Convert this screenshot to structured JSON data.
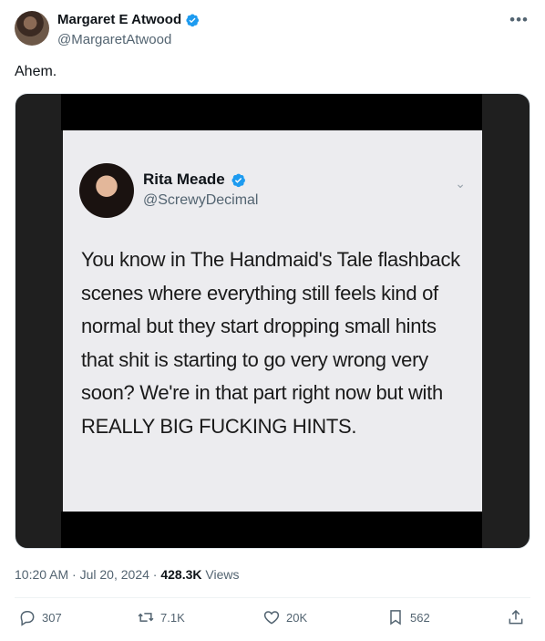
{
  "author": {
    "name": "Margaret E Atwood",
    "handle": "@MargaretAtwood"
  },
  "post": {
    "text": "Ahem."
  },
  "media": {
    "embedded_post": {
      "name": "Rita Meade",
      "handle": "@ScrewyDecimal",
      "text": "You know in The Handmaid's Tale flashback scenes where everything still feels kind of normal but they start dropping small hints that shit is starting to go very wrong very soon? We're in that part right now but with REALLY BIG FUCKING HINTS."
    }
  },
  "meta": {
    "time": "10:20 AM",
    "separator": " · ",
    "date": "Jul 20, 2024",
    "views_count": "428.3K",
    "views_label": " Views"
  },
  "actions": {
    "replies": "307",
    "reposts": "7.1K",
    "likes": "20K",
    "bookmarks": "562"
  },
  "colors": {
    "verified": "#1d9bf0",
    "muted": "#536471"
  }
}
